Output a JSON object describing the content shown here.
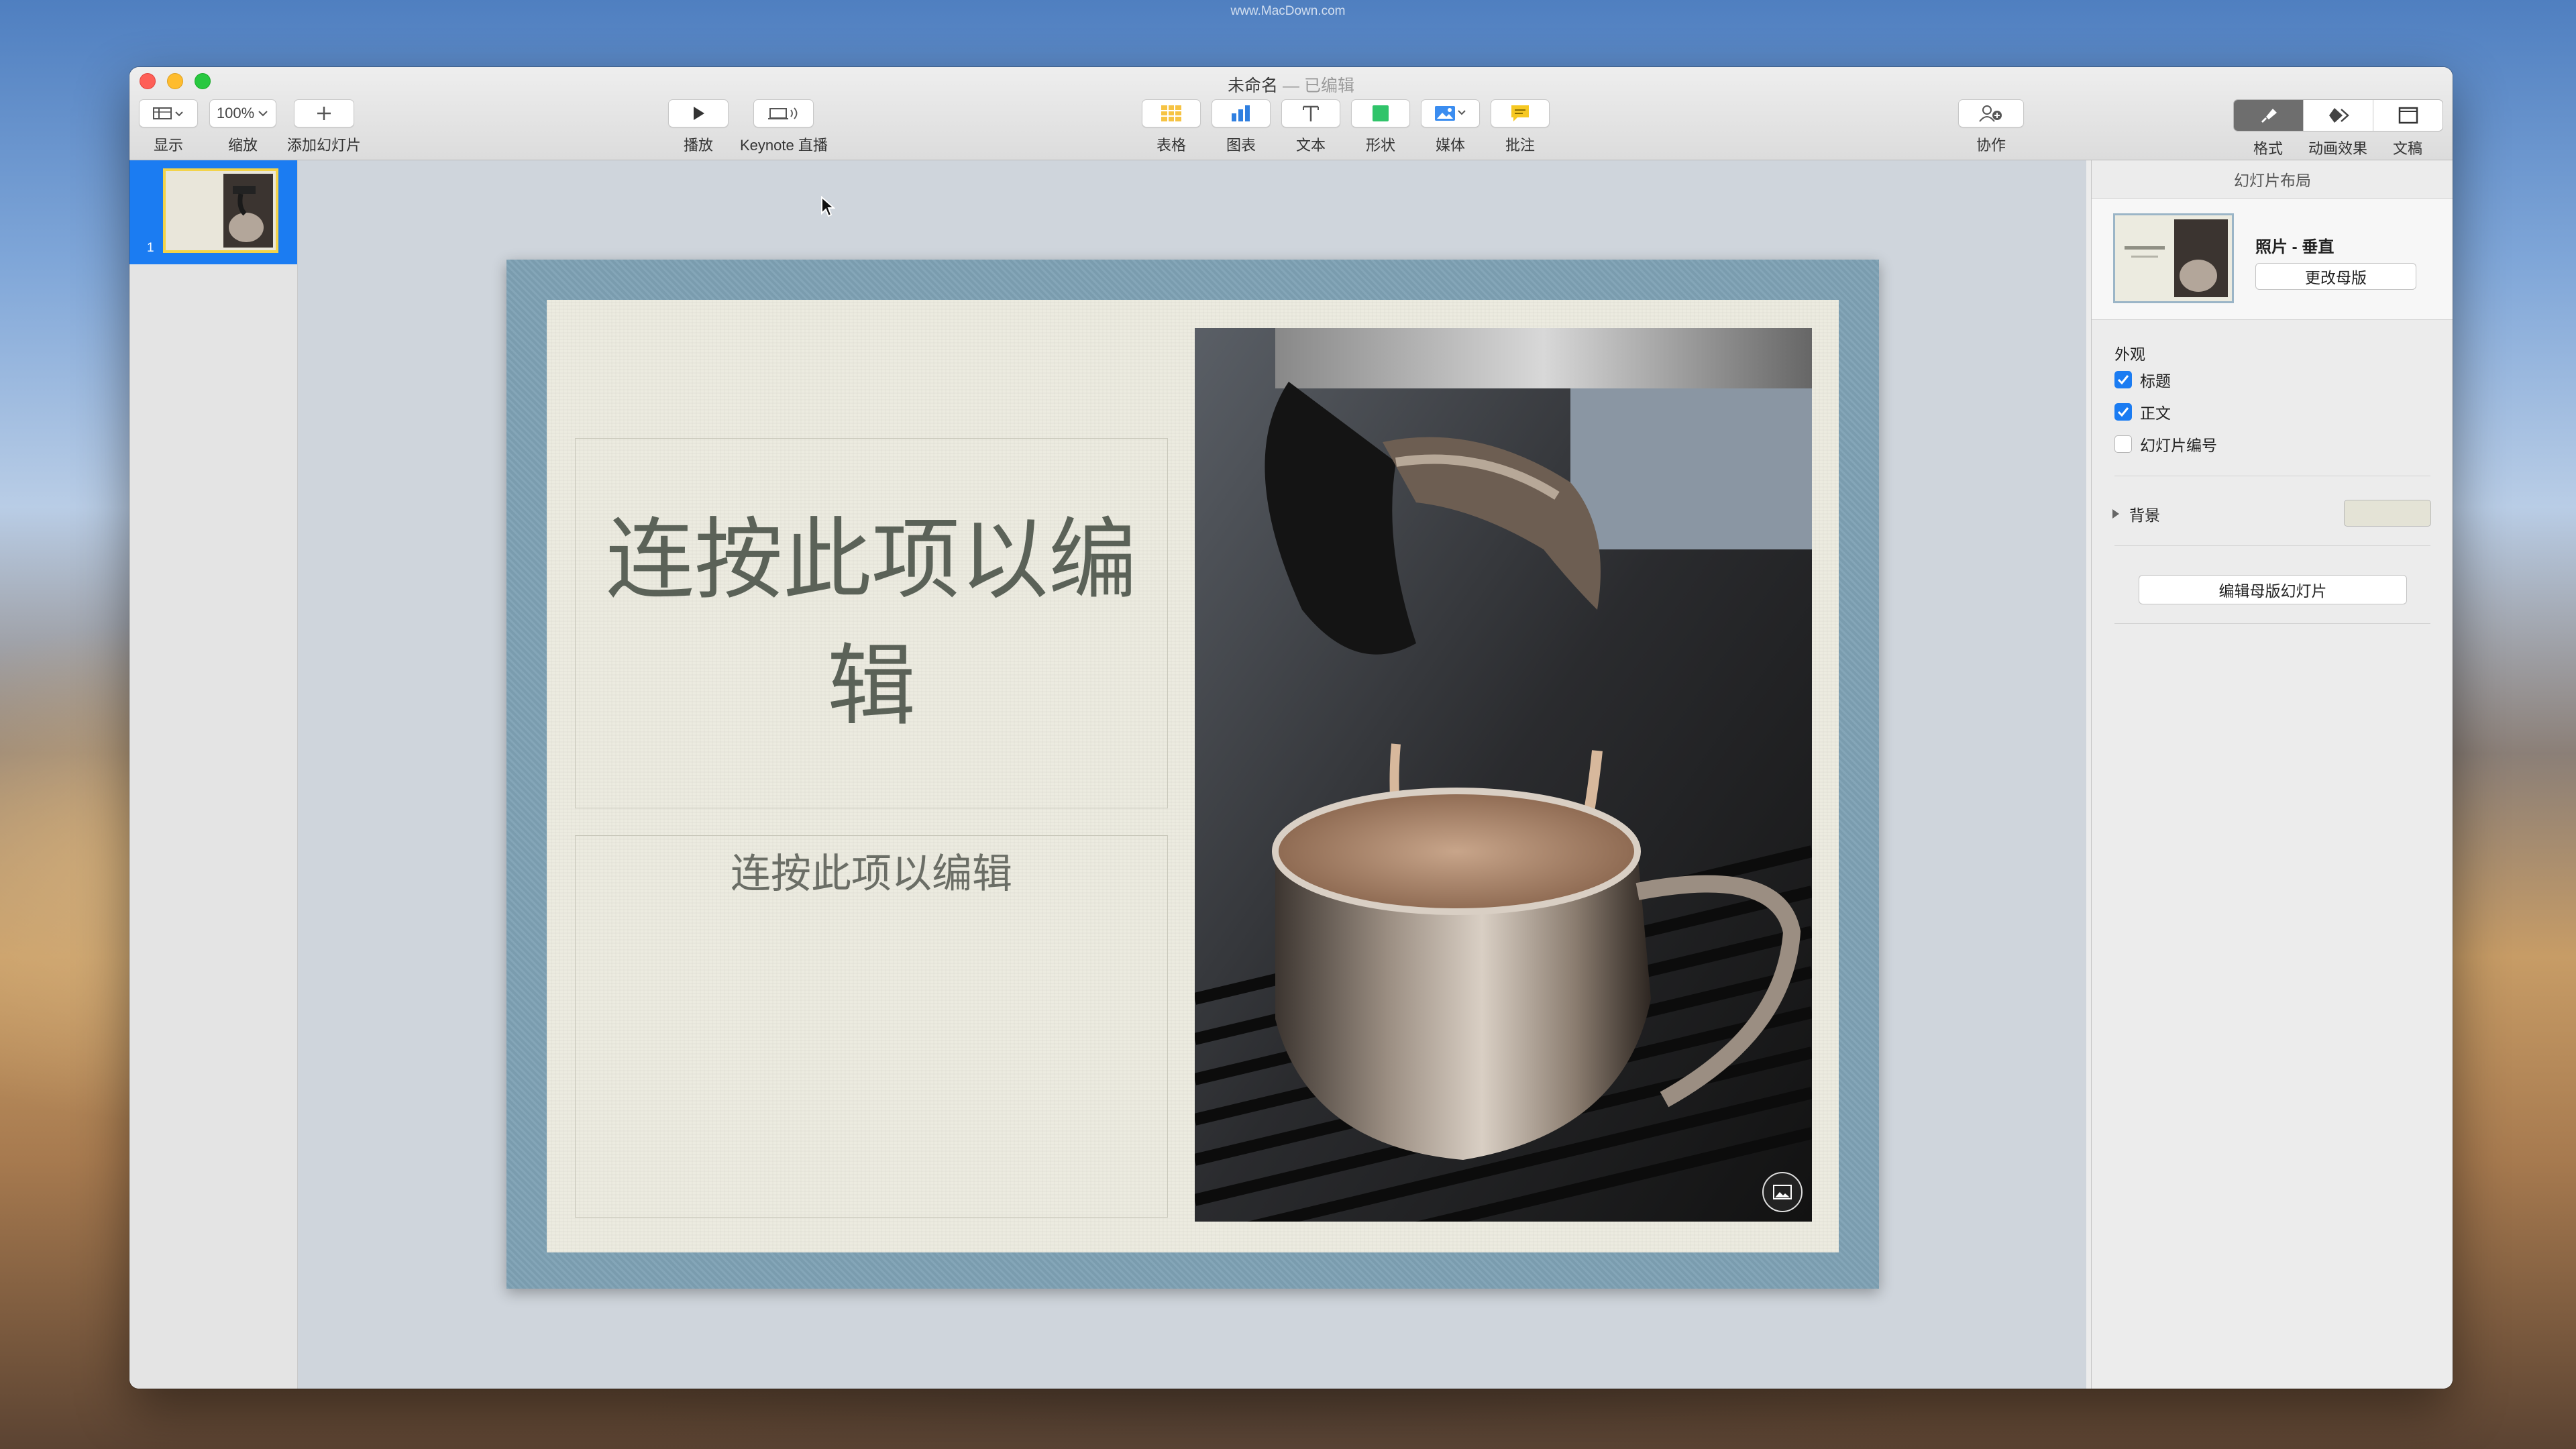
{
  "watermark": "www.MacDown.com",
  "window": {
    "title": "未命名",
    "subtitle": " — 已编辑"
  },
  "toolbar": {
    "view_label": "显示",
    "zoom_value": "100%",
    "zoom_label": "缩放",
    "add_slide_label": "添加幻灯片",
    "play_label": "播放",
    "keynote_live_label": "Keynote 直播",
    "table_label": "表格",
    "chart_label": "图表",
    "text_label": "文本",
    "shape_label": "形状",
    "media_label": "媒体",
    "comment_label": "批注",
    "collaborate_label": "协作",
    "format_label": "格式",
    "animate_label": "动画效果",
    "document_label": "文稿"
  },
  "navigator": {
    "slide_number": "1"
  },
  "slide": {
    "title": "连按此项以编辑",
    "body": "连按此项以编辑"
  },
  "inspector": {
    "header": "幻灯片布局",
    "layout_name": "照片 - 垂直",
    "change_master_label": "更改母版",
    "appearance_label": "外观",
    "options": [
      {
        "label": "标题",
        "checked": true
      },
      {
        "label": "正文",
        "checked": true
      },
      {
        "label": "幻灯片编号",
        "checked": false
      }
    ],
    "background_label": "背景",
    "background_color": "#e4e3d6",
    "edit_master_label": "编辑母版幻灯片"
  },
  "colors": {
    "accent": "#1b7cf2",
    "selection_border": "#f3d34a"
  }
}
